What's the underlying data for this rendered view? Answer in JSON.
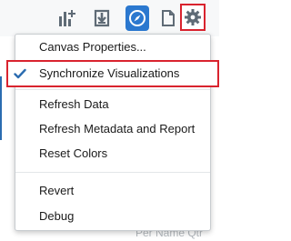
{
  "toolbar": {
    "buttons": [
      {
        "name": "add-visualization-button",
        "icon": "bar-chart-plus-icon"
      },
      {
        "name": "import-button",
        "icon": "import-icon"
      },
      {
        "name": "explore-button",
        "icon": "compass-icon",
        "active": true
      },
      {
        "name": "page-button",
        "icon": "page-icon"
      },
      {
        "name": "settings-button",
        "icon": "gear-icon",
        "highlighted": true
      }
    ]
  },
  "menu": {
    "items": [
      {
        "label": "Canvas Properties..."
      },
      {
        "label": "Synchronize Visualizations",
        "checked": true
      },
      {
        "label": "Refresh Data"
      },
      {
        "label": "Refresh Metadata and Report"
      },
      {
        "label": "Reset Colors"
      },
      {
        "label": "Revert"
      },
      {
        "label": "Debug"
      }
    ]
  },
  "background": {
    "faded_text": "Per Name Qtr"
  },
  "colors": {
    "accent_blue": "#2b78cf",
    "highlight_red": "#d9232e",
    "icon_gray": "#5f6b76",
    "check_blue": "#2b6cb0"
  }
}
